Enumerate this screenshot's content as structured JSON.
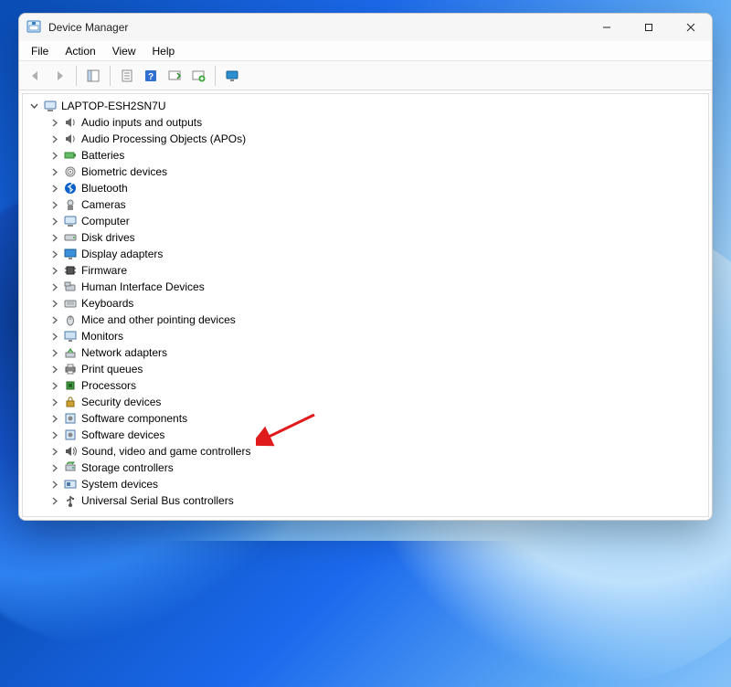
{
  "window": {
    "title": "Device Manager"
  },
  "menu": {
    "file": "File",
    "action": "Action",
    "view": "View",
    "help": "Help"
  },
  "tree": {
    "root": "LAPTOP-ESH2SN7U",
    "items": [
      {
        "label": "Audio inputs and outputs",
        "icon": "speaker"
      },
      {
        "label": "Audio Processing Objects (APOs)",
        "icon": "speaker"
      },
      {
        "label": "Batteries",
        "icon": "battery"
      },
      {
        "label": "Biometric devices",
        "icon": "fingerprint"
      },
      {
        "label": "Bluetooth",
        "icon": "bluetooth"
      },
      {
        "label": "Cameras",
        "icon": "camera"
      },
      {
        "label": "Computer",
        "icon": "computer"
      },
      {
        "label": "Disk drives",
        "icon": "disk"
      },
      {
        "label": "Display adapters",
        "icon": "display"
      },
      {
        "label": "Firmware",
        "icon": "chip"
      },
      {
        "label": "Human Interface Devices",
        "icon": "hid"
      },
      {
        "label": "Keyboards",
        "icon": "keyboard"
      },
      {
        "label": "Mice and other pointing devices",
        "icon": "mouse"
      },
      {
        "label": "Monitors",
        "icon": "monitor"
      },
      {
        "label": "Network adapters",
        "icon": "network"
      },
      {
        "label": "Print queues",
        "icon": "printer"
      },
      {
        "label": "Processors",
        "icon": "cpu"
      },
      {
        "label": "Security devices",
        "icon": "security"
      },
      {
        "label": "Software components",
        "icon": "software"
      },
      {
        "label": "Software devices",
        "icon": "software"
      },
      {
        "label": "Sound, video and game controllers",
        "icon": "sound"
      },
      {
        "label": "Storage controllers",
        "icon": "storage"
      },
      {
        "label": "System devices",
        "icon": "system"
      },
      {
        "label": "Universal Serial Bus controllers",
        "icon": "usb"
      }
    ]
  },
  "annotation": {
    "arrow_target_index": 20,
    "arrow_color": "#e01b1b"
  }
}
